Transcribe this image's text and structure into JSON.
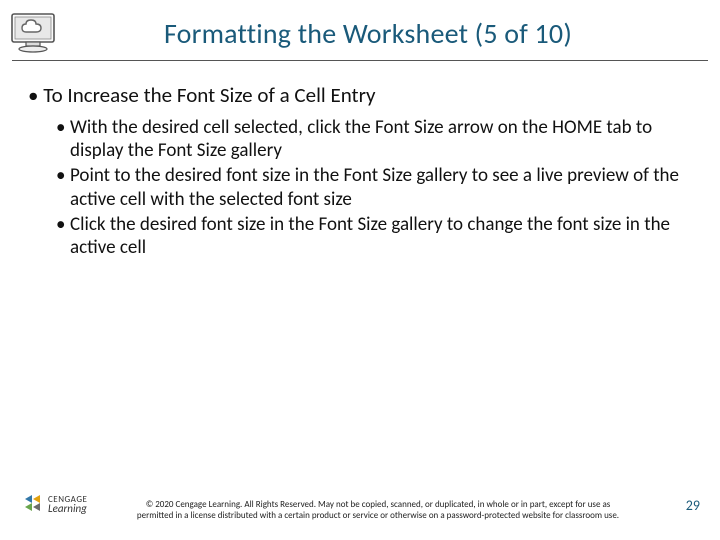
{
  "header": {
    "title": "Formatting the Worksheet (5 of 10)",
    "icon_name": "monitor-cloud-icon"
  },
  "body": {
    "heading": "To Increase the Font Size of a Cell Entry",
    "sub_bullets": [
      "With the desired cell selected, click the Font Size arrow on the HOME tab to display the Font Size gallery",
      "Point to the desired font size in the Font Size gallery to see a live preview of the active cell with the selected font size",
      "Click the desired font size in the Font Size gallery to change the font size in the active cell"
    ]
  },
  "footer": {
    "logo_line1": "CENGAGE",
    "logo_line2": "Learning",
    "copyright": "© 2020 Cengage Learning. All Rights Reserved. May not be copied, scanned, or duplicated, in whole or in part, except for use as permitted in a license distributed with a certain product or service or otherwise on a password-protected website for classroom use.",
    "page_number": "29"
  },
  "colors": {
    "title": "#1a5a7a"
  }
}
